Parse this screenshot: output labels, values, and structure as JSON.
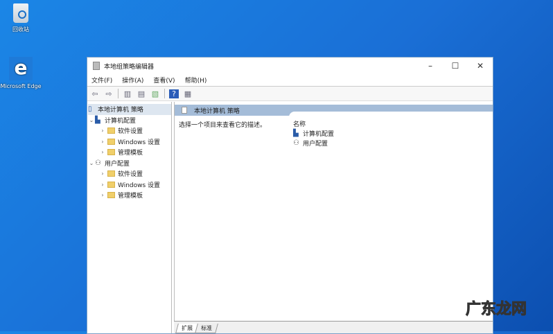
{
  "desktop": {
    "icons": [
      {
        "label": "回收站"
      },
      {
        "label": "Microsoft Edge"
      }
    ]
  },
  "window": {
    "title": "本地组策略编辑器",
    "controls": {
      "minimize": "–",
      "maximize": "☐",
      "close": "✕"
    }
  },
  "menu": [
    "文件(F)",
    "操作(A)",
    "查看(V)",
    "帮助(H)"
  ],
  "tree": {
    "root": "本地计算机 策略",
    "computer": "计算机配置",
    "user": "用户配置",
    "children": [
      "软件设置",
      "Windows 设置",
      "管理模板"
    ]
  },
  "main": {
    "header": "本地计算机 策略",
    "description": "选择一个项目来查看它的描述。",
    "column": "名称",
    "items": [
      "计算机配置",
      "用户配置"
    ]
  },
  "tabs": [
    "扩展",
    "标准"
  ],
  "watermark": "广东龙网"
}
